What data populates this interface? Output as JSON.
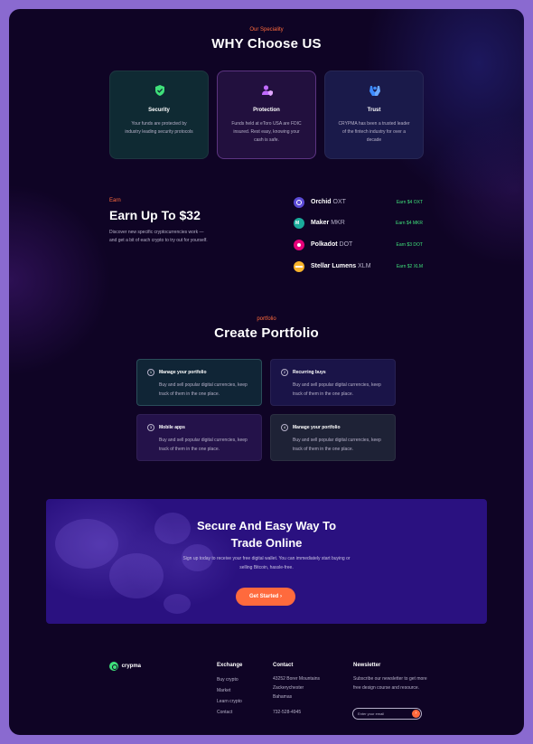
{
  "why": {
    "eyebrow": "Our Speciality",
    "title": "WHY Choose US",
    "cards": [
      {
        "title": "Security",
        "desc": "Your funds are protected by industry leading security protocols",
        "icon": "shield-icon",
        "color": "#3fe07a"
      },
      {
        "title": "Protection",
        "desc": "Funds held at eToro USA are FDIC insured. Rest easy, knowing your cash is safe.",
        "icon": "user-shield-icon",
        "color": "#c06bff"
      },
      {
        "title": "Trust",
        "desc": "CRYPMA has been a trusted leader of the fintech industry for over a decade",
        "icon": "hands-icon",
        "color": "#3d8bff"
      }
    ]
  },
  "earn": {
    "eyebrow": "Earn",
    "title": "Earn Up To $32",
    "desc": "Discover new specific cryptocurrencies work — and get a bit of each crypto to try out for yourself.",
    "coins": [
      {
        "name": "Orchid",
        "ticker": "OXT",
        "earn": "Earn $4 OXT",
        "icon": "orchid-icon",
        "color": "#5b4bd6"
      },
      {
        "name": "Maker",
        "ticker": "MKR",
        "earn": "Earn $4 MKR",
        "icon": "maker-icon",
        "color": "#1aab9b"
      },
      {
        "name": "Polkadot",
        "ticker": "DOT",
        "earn": "Earn $3 DOT",
        "icon": "polkadot-icon",
        "color": "#e6007a"
      },
      {
        "name": "Stellar Lumens",
        "ticker": "XLM",
        "earn": "Earn $2 XLM",
        "icon": "stellar-icon",
        "color": "#f7b32b"
      }
    ]
  },
  "portfolio": {
    "eyebrow": "portfolio",
    "title": "Create Portfolio",
    "cards": [
      {
        "num": "1",
        "title": "Manage your portfolio",
        "desc": "Buy and sell popular digital currencies, keep track of them in the one place."
      },
      {
        "num": "2",
        "title": "Recurring buys",
        "desc": "Buy and sell popular digital currencies, keep track of them in the one place."
      },
      {
        "num": "3",
        "title": "Mobile apps",
        "desc": "Buy and sell popular digital currencies, keep track of them in the one place."
      },
      {
        "num": "4",
        "title": "Manage your portfolio",
        "desc": "Buy and sell popular digital currencies, keep track of them in the one place."
      }
    ]
  },
  "cta": {
    "title_line1": "Secure And Easy Way To",
    "title_line2": "Trade Online",
    "desc": "Sign up today to receive your free digital wallet. You can immediately start buying or selling Bitcoin, hassle-free.",
    "button": "Get Started",
    "button_icon": "chevron-right-icon"
  },
  "footer": {
    "brand": "crypma",
    "exchange": {
      "title": "Exchange",
      "links": [
        "Buy crypto",
        "Market",
        "Learn crypto",
        "Contact"
      ]
    },
    "contact": {
      "title": "Contact",
      "address": [
        "43252 Borer Mountains",
        "Zackerychester",
        "Bahamas"
      ],
      "phone": "732-528-4945"
    },
    "newsletter": {
      "title": "Newsletter",
      "desc": "Subscribe our newsletter to get more free design course and resource.",
      "placeholder": "Enter your email"
    }
  }
}
